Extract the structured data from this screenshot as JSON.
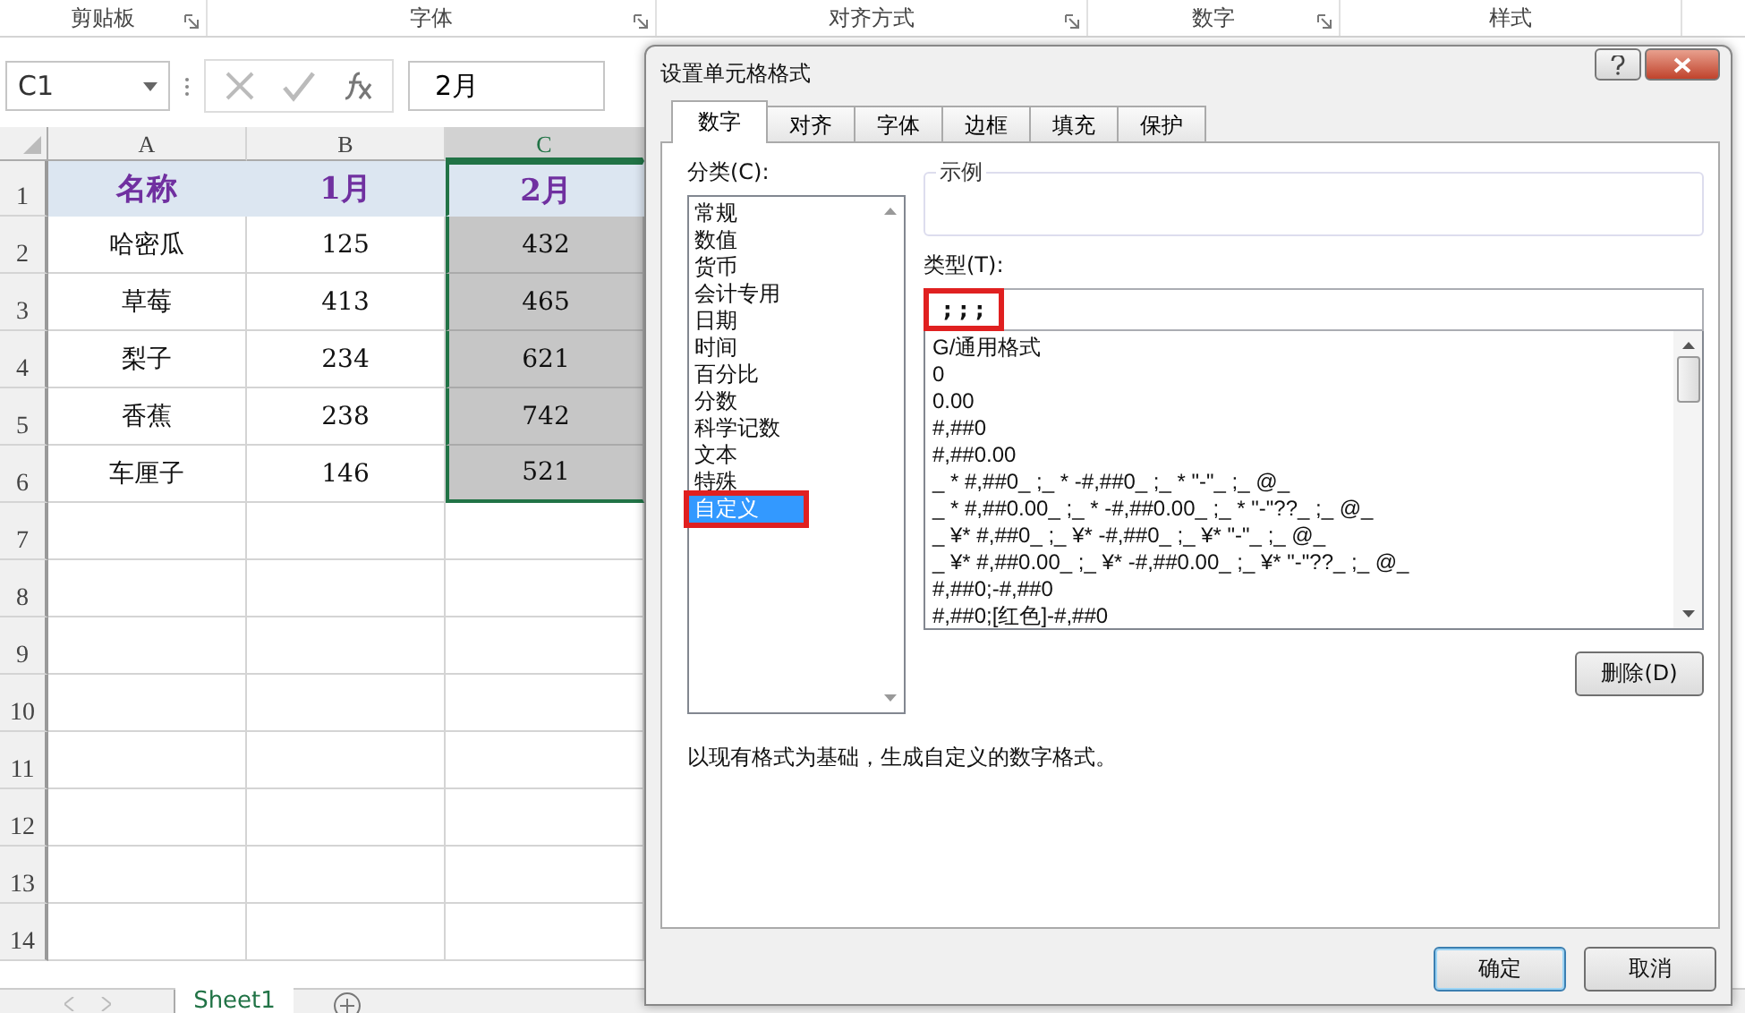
{
  "ribbon_groups": [
    {
      "label": "剪贴板",
      "launcher": true
    },
    {
      "label": "字体",
      "launcher": true
    },
    {
      "label": "对齐方式",
      "launcher": true
    },
    {
      "label": "数字",
      "launcher": true
    },
    {
      "label": "样式",
      "launcher": false
    }
  ],
  "formula_bar": {
    "name_box": "C1",
    "formula": "2月"
  },
  "sheet": {
    "columns": [
      {
        "label": "A",
        "selected": false
      },
      {
        "label": "B",
        "selected": false
      },
      {
        "label": "C",
        "selected": true
      }
    ],
    "rows": [
      {
        "number": "1",
        "header": true,
        "cells": [
          "名称",
          "1月",
          "2月"
        ]
      },
      {
        "number": "2",
        "header": false,
        "cells": [
          "哈密瓜",
          "125",
          "432"
        ]
      },
      {
        "number": "3",
        "header": false,
        "cells": [
          "草莓",
          "413",
          "465"
        ]
      },
      {
        "number": "4",
        "header": false,
        "cells": [
          "梨子",
          "234",
          "621"
        ]
      },
      {
        "number": "5",
        "header": false,
        "cells": [
          "香蕉",
          "238",
          "742"
        ]
      },
      {
        "number": "6",
        "header": false,
        "cells": [
          "车厘子",
          "146",
          "521"
        ]
      },
      {
        "number": "7",
        "header": false,
        "cells": [
          "",
          "",
          ""
        ]
      },
      {
        "number": "8",
        "header": false,
        "cells": [
          "",
          "",
          ""
        ]
      },
      {
        "number": "9",
        "header": false,
        "cells": [
          "",
          "",
          ""
        ]
      },
      {
        "number": "10",
        "header": false,
        "cells": [
          "",
          "",
          ""
        ]
      },
      {
        "number": "11",
        "header": false,
        "cells": [
          "",
          "",
          ""
        ]
      },
      {
        "number": "12",
        "header": false,
        "cells": [
          "",
          "",
          ""
        ]
      },
      {
        "number": "13",
        "header": false,
        "cells": [
          "",
          "",
          ""
        ]
      },
      {
        "number": "14",
        "header": false,
        "cells": [
          "",
          "",
          ""
        ]
      }
    ],
    "tabs": [
      {
        "label": "Sheet1",
        "selected": true
      }
    ]
  },
  "dialog": {
    "title": "设置单元格格式",
    "tabs": [
      {
        "label": "数字",
        "selected": true
      },
      {
        "label": "对齐",
        "selected": false
      },
      {
        "label": "字体",
        "selected": false
      },
      {
        "label": "边框",
        "selected": false
      },
      {
        "label": "填充",
        "selected": false
      },
      {
        "label": "保护",
        "selected": false
      }
    ],
    "category_label": "分类(C):",
    "categories": [
      {
        "label": "常规",
        "selected": false,
        "highlighted": false
      },
      {
        "label": "数值",
        "selected": false,
        "highlighted": false
      },
      {
        "label": "货币",
        "selected": false,
        "highlighted": false
      },
      {
        "label": "会计专用",
        "selected": false,
        "highlighted": false
      },
      {
        "label": "日期",
        "selected": false,
        "highlighted": false
      },
      {
        "label": "时间",
        "selected": false,
        "highlighted": false
      },
      {
        "label": "百分比",
        "selected": false,
        "highlighted": false
      },
      {
        "label": "分数",
        "selected": false,
        "highlighted": false
      },
      {
        "label": "科学记数",
        "selected": false,
        "highlighted": false
      },
      {
        "label": "文本",
        "selected": false,
        "highlighted": false
      },
      {
        "label": "特殊",
        "selected": false,
        "highlighted": false
      },
      {
        "label": "自定义",
        "selected": true,
        "highlighted": true
      }
    ],
    "sample_label": "示例",
    "type_label": "类型(T):",
    "type_value": "; ; ;",
    "type_highlighted": true,
    "formats": [
      {
        "label": "G/通用格式",
        "selected": false
      },
      {
        "label": "0",
        "selected": false
      },
      {
        "label": "0.00",
        "selected": false
      },
      {
        "label": "#,##0",
        "selected": false
      },
      {
        "label": "#,##0.00",
        "selected": false
      },
      {
        "label": "_ * #,##0_ ;_ * -#,##0_ ;_ * \"-\"_ ;_ @_",
        "selected": false
      },
      {
        "label": "_ * #,##0.00_ ;_ * -#,##0.00_ ;_ * \"-\"??_ ;_ @_",
        "selected": false
      },
      {
        "label": "_ ¥* #,##0_ ;_ ¥* -#,##0_ ;_ ¥* \"-\"_ ;_ @_",
        "selected": false
      },
      {
        "label": "_ ¥* #,##0.00_ ;_ ¥* -#,##0.00_ ;_ ¥* \"-\"??_ ;_ @_",
        "selected": false
      },
      {
        "label": "#,##0;-#,##0",
        "selected": false
      },
      {
        "label": "#,##0;[红色]-#,##0",
        "selected": false
      }
    ],
    "delete_button": "删除(D)",
    "description": "以现有格式为基础，生成自定义的数字格式。",
    "ok_button": "确定",
    "cancel_button": "取消"
  }
}
